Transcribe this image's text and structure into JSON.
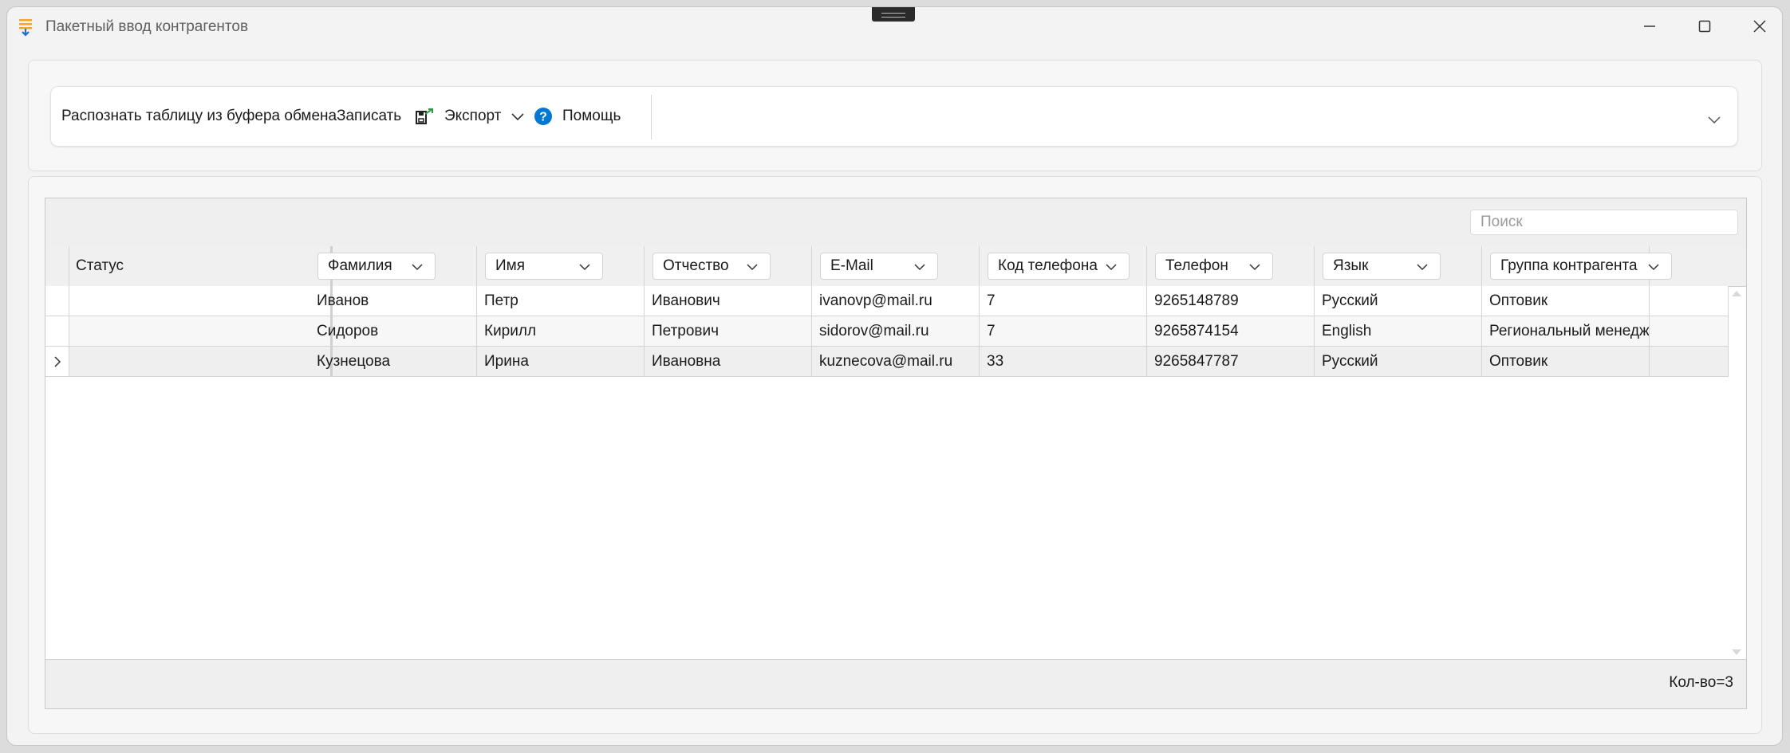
{
  "window": {
    "title": "Пакетный ввод контрагентов"
  },
  "toolbar": {
    "recognize_label": "Распознать таблицу из буфера обмена",
    "save_label": "Записать",
    "export_label": "Экспорт",
    "help_label": "Помощь"
  },
  "search": {
    "placeholder": "Поиск"
  },
  "grid": {
    "status_header": "Статус",
    "columns": [
      "Фамилия",
      "Имя",
      "Отчество",
      "E-Mail",
      "Код телефона",
      "Телефон",
      "Язык",
      "Группа контрагента"
    ],
    "rows": [
      [
        "Иванов",
        "Петр",
        "Иванович",
        "ivanovp@mail.ru",
        "7",
        "9265148789",
        "Русский",
        "Оптовик"
      ],
      [
        "Сидоров",
        "Кирилл",
        "Петрович",
        "sidorov@mail.ru",
        "7",
        "9265874154",
        "English",
        "Региональный менеджер"
      ],
      [
        "Кузнецова",
        "Ирина",
        "Ивановна",
        "kuznecova@mail.ru",
        "33",
        "9265847787",
        "Русский",
        "Оптовик"
      ]
    ],
    "current_row": 2
  },
  "footer": {
    "count": "Кол-во=3"
  },
  "colors": {
    "help_icon": "#0078d4",
    "app_icon": "#f5a623",
    "current_row_bg": "#efefef",
    "alt_row_bg": "#f7f7f7"
  }
}
